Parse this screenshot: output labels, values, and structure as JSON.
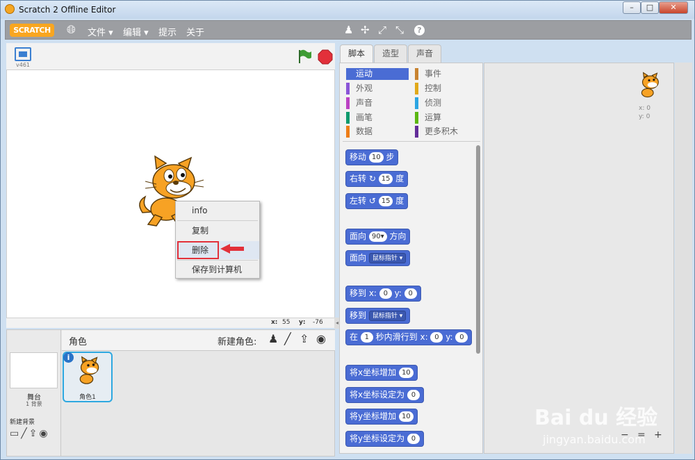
{
  "window": {
    "title": "Scratch 2 Offline Editor",
    "min": "–",
    "max": "□",
    "close": "✕"
  },
  "menubar": {
    "logo": "SCRATCH",
    "globe_icon": "globe-icon",
    "items": [
      {
        "label": "文件 ▾"
      },
      {
        "label": "编辑 ▾"
      },
      {
        "label": "提示"
      },
      {
        "label": "关于"
      }
    ],
    "tools": [
      {
        "glyph": "♟",
        "icon": "duplicate-icon"
      },
      {
        "glyph": "✢",
        "icon": "delete-scissors-icon"
      },
      {
        "glyph": "⤢",
        "icon": "grow-icon"
      },
      {
        "glyph": "⤡",
        "icon": "shrink-icon"
      },
      {
        "glyph": "?",
        "icon": "help-icon"
      }
    ]
  },
  "stage": {
    "version": "v461",
    "green_flag_icon": "green-flag-icon",
    "stop_icon": "stop-icon",
    "x_label": "x:",
    "x_value": "55",
    "y_label": "y:",
    "y_value": "-76"
  },
  "context_menu": {
    "items": [
      {
        "label": "info"
      },
      {
        "label": "复制"
      },
      {
        "label": "删除"
      },
      {
        "label": "保存到计算机"
      }
    ]
  },
  "sprites": {
    "title": "角色",
    "new_sprite_label": "新建角色:",
    "stage_label": "舞台",
    "backdrop_count": "1 背景",
    "new_backdrop_label": "新建背景",
    "sprite_name": "角色1",
    "info_glyph": "i"
  },
  "tabs": [
    {
      "label": "脚本"
    },
    {
      "label": "造型"
    },
    {
      "label": "声音"
    }
  ],
  "categories": [
    {
      "label": "运动",
      "color": "#4a6cd4"
    },
    {
      "label": "外观",
      "color": "#8a55d7"
    },
    {
      "label": "声音",
      "color": "#bb42c3"
    },
    {
      "label": "画笔",
      "color": "#0e9a6c"
    },
    {
      "label": "数据",
      "color": "#ee7d16"
    },
    {
      "label": "事件",
      "color": "#c88330"
    },
    {
      "label": "控制",
      "color": "#e1a91a"
    },
    {
      "label": "侦测",
      "color": "#2ca5e2"
    },
    {
      "label": "运算",
      "color": "#5cb712"
    },
    {
      "label": "更多积木",
      "color": "#632d99"
    }
  ],
  "blocks": {
    "move": {
      "a": "移动",
      "v": "10",
      "b": "步"
    },
    "turn_right": {
      "a": "右转",
      "icon": "↻",
      "v": "15",
      "b": "度"
    },
    "turn_left": {
      "a": "左转",
      "icon": "↺",
      "v": "15",
      "b": "度"
    },
    "point_dir": {
      "a": "面向",
      "v": "90▾",
      "b": "方向"
    },
    "point_toward": {
      "a": "面向",
      "dd": "鼠标指针 ▾"
    },
    "goto_xy": {
      "a": "移到 x:",
      "v1": "0",
      "b": "y:",
      "v2": "0"
    },
    "goto": {
      "a": "移到",
      "dd": "鼠标指针 ▾"
    },
    "glide": {
      "a": "在",
      "v1": "1",
      "b": "秒内滑行到 x:",
      "v2": "0",
      "c": "y:",
      "v3": "0"
    },
    "change_x": {
      "a": "将x坐标增加",
      "v": "10"
    },
    "set_x": {
      "a": "将x坐标设定为",
      "v": "0"
    },
    "change_y": {
      "a": "将y坐标增加",
      "v": "10"
    },
    "set_y": {
      "a": "将y坐标设定为",
      "v": "0"
    }
  },
  "scripts_area": {
    "help": "?",
    "sprite_x": "x: 0",
    "sprite_y": "y: 0",
    "zoom_out": "−",
    "zoom_reset": "=",
    "zoom_in": "+"
  },
  "watermark": {
    "brand": "Bai du 经验",
    "url": "jingyan.baidu.com"
  },
  "colors": {
    "accent_red": "#e2303a",
    "block_blue": "#4a6cd4",
    "selected_category": "#4a6cd4"
  }
}
